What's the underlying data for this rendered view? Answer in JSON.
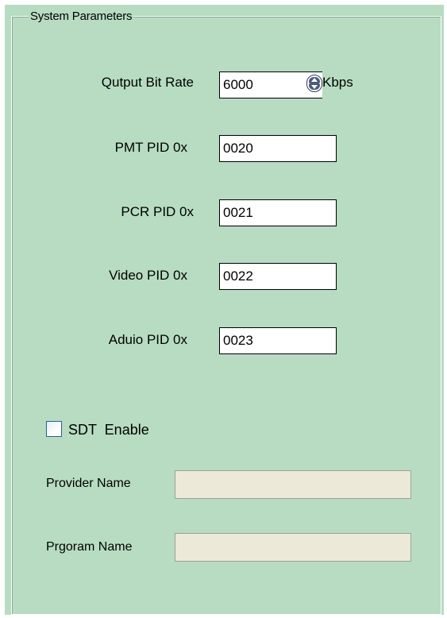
{
  "group": {
    "title": "System Parameters"
  },
  "fields": [
    {
      "label": "Qutput  Bit Rate",
      "value": "6000",
      "unit": "Kbps"
    },
    {
      "label": "PMT PID 0x",
      "value": "0020"
    },
    {
      "label": "PCR PID 0x",
      "value": "0021"
    },
    {
      "label": "Video PID 0x",
      "value": "0022"
    },
    {
      "label": "Aduio PID 0x",
      "value": "0023"
    }
  ],
  "sdt": {
    "label": "SDT  Enable",
    "checked": false,
    "provider_label": "Provider Name",
    "provider_value": "",
    "program_label": "Prgoram Name",
    "program_value": ""
  },
  "icons": {
    "spinner": "up-down-spin-icon"
  },
  "colors": {
    "panel_background": "#b7dcc2",
    "disabled_field": "#ece9d8"
  }
}
